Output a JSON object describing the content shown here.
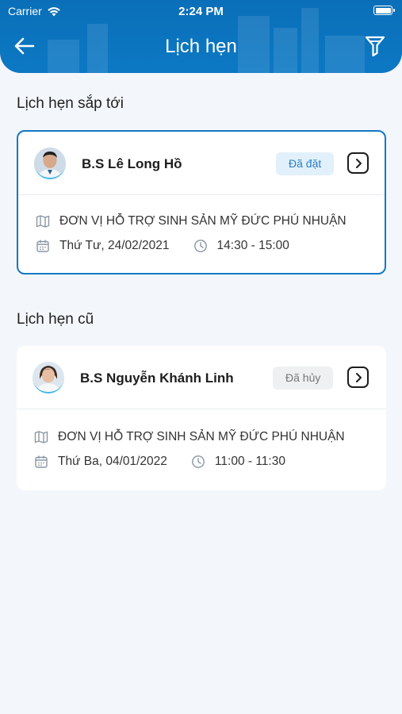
{
  "status_bar": {
    "carrier": "Carrier",
    "time": "2:24 PM"
  },
  "header": {
    "title": "Lịch hẹn",
    "back_icon": "arrow-left-icon",
    "filter_icon": "filter-icon"
  },
  "colors": {
    "primary": "#0c78c4",
    "accent": "#40b6ea"
  },
  "upcoming": {
    "section_title": "Lịch hẹn sắp tới",
    "appointments": [
      {
        "doctor": "B.S Lê Long Hồ",
        "status": "Đã đặt",
        "location": "ĐƠN VỊ HỖ TRỢ SINH SẢN MỸ ĐỨC PHÚ NHUẬN",
        "date": "Thứ Tư, 24/02/2021",
        "time": "14:30 - 15:00"
      }
    ]
  },
  "past": {
    "section_title": "Lịch hẹn cũ",
    "appointments": [
      {
        "doctor": "B.S Nguyễn Khánh Linh",
        "status": "Đã hủy",
        "location": "ĐƠN VỊ HỖ TRỢ SINH SẢN MỸ ĐỨC PHÚ NHUẬN",
        "date": "Thứ Ba, 04/01/2022",
        "time": "11:00 - 11:30"
      }
    ]
  }
}
